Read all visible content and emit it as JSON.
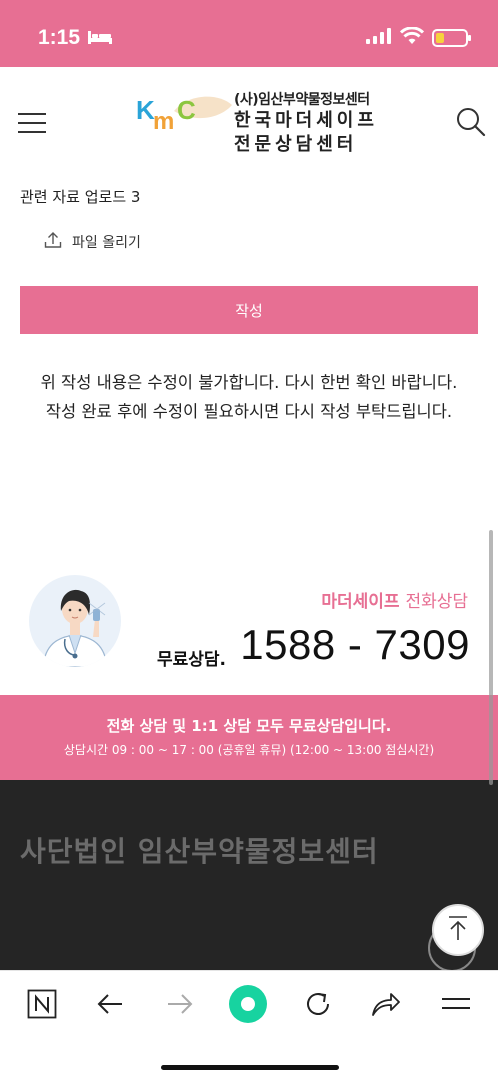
{
  "status_bar": {
    "time": "1:15",
    "accent_color": "#e76f93",
    "battery_level": 0.3,
    "icons": [
      "bed-icon",
      "signal-icon",
      "wifi-icon",
      "battery-icon"
    ]
  },
  "header": {
    "logo_mark": "KMC",
    "logo_sub": "(사)임산부약물정보센터",
    "logo_line1": "한국마더세이프",
    "logo_line2": "전문상담센터",
    "menu_icon": "hamburger-menu-icon",
    "search_icon": "search-icon"
  },
  "form": {
    "upload_label": "관련 자료 업로드 3",
    "file_upload_label": "파일 올리기",
    "submit_label": "작성",
    "notice_line1": "위 작성 내용은 수정이 불가합니다. 다시 한번 확인 바랍니다.",
    "notice_line2": "작성 완료 후에 수정이 필요하시면 다시 작성 부탁드립니다."
  },
  "contact": {
    "brand": "마더세이프",
    "brand_suffix": "전화상담",
    "free_label": "무료상담.",
    "phone": "1588 - 7309"
  },
  "info_band": {
    "title": "전화 상담 및 1:1 상담 모두 무료상담입니다.",
    "hours": "상담시간 09 : 00 ~ 17 : 00 (공휴일 휴뮤) (12:00 ~ 13:00 점심시간)"
  },
  "footer": {
    "title": "사단법인 임산부약물정보센터"
  },
  "browser_toolbar": {
    "buttons": [
      "naver-n-icon",
      "back-arrow-icon",
      "forward-arrow-icon",
      "home-dot-icon",
      "refresh-icon",
      "share-icon",
      "menu-lines-icon"
    ]
  }
}
